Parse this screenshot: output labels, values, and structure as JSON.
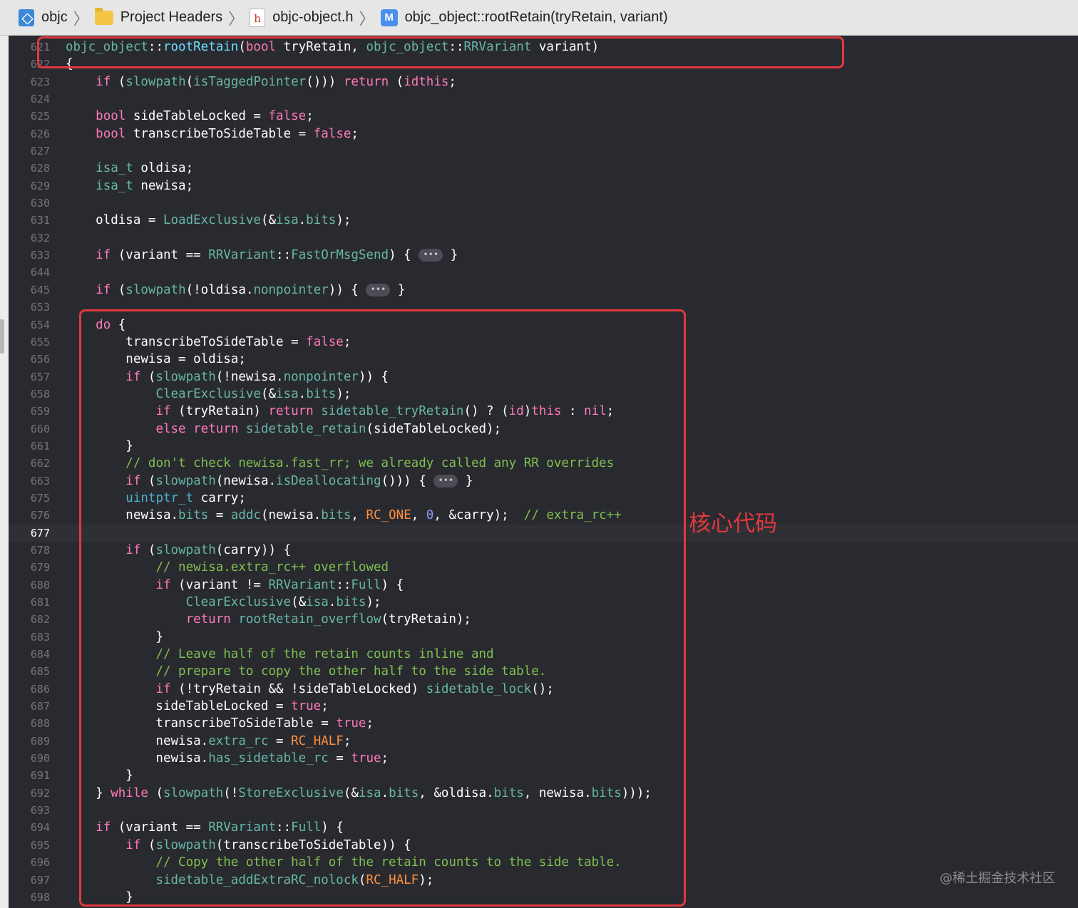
{
  "breadcrumb": {
    "items": [
      {
        "label": "objc",
        "icon": "project-icon"
      },
      {
        "label": "Project Headers",
        "icon": "folder-icon"
      },
      {
        "label": "objc-object.h",
        "icon": "header-file-icon",
        "glyph": "h"
      },
      {
        "label": "objc_object::rootRetain(tryRetain, variant)",
        "icon": "method-icon",
        "glyph": "M"
      }
    ]
  },
  "editor": {
    "current_line": "677",
    "fold_glyph": "•••",
    "lines": [
      {
        "n": "621",
        "tokens": [
          [
            "md",
            "objc_object"
          ],
          [
            "",
            "::"
          ],
          [
            "fg2",
            "rootRetain"
          ],
          [
            "",
            "("
          ],
          [
            "kw",
            "bool"
          ],
          [
            "",
            " tryRetain, "
          ],
          [
            "md",
            "objc_object"
          ],
          [
            "",
            "::"
          ],
          [
            "md",
            "RRVariant"
          ],
          [
            "",
            " variant)"
          ]
        ]
      },
      {
        "n": "622",
        "tokens": [
          [
            "",
            "{"
          ]
        ]
      },
      {
        "n": "623",
        "tokens": [
          [
            "",
            "    "
          ],
          [
            "kw",
            "if"
          ],
          [
            "",
            " ("
          ],
          [
            "fcall",
            "slowpath"
          ],
          [
            "",
            "("
          ],
          [
            "fcall",
            "isTaggedPointer"
          ],
          [
            "",
            "())) "
          ],
          [
            "kw",
            "return"
          ],
          [
            "",
            " ("
          ],
          [
            "kw",
            "id"
          ],
          [
            ")"
          ],
          [
            "kw",
            "this"
          ],
          [
            "",
            ";"
          ]
        ]
      },
      {
        "n": "624",
        "tokens": []
      },
      {
        "n": "625",
        "tokens": [
          [
            "",
            "    "
          ],
          [
            "kw",
            "bool"
          ],
          [
            "",
            " sideTableLocked = "
          ],
          [
            "kw",
            "false"
          ],
          [
            "",
            ";"
          ]
        ]
      },
      {
        "n": "626",
        "tokens": [
          [
            "",
            "    "
          ],
          [
            "kw",
            "bool"
          ],
          [
            "",
            " transcribeToSideTable = "
          ],
          [
            "kw",
            "false"
          ],
          [
            "",
            ";"
          ]
        ]
      },
      {
        "n": "627",
        "tokens": []
      },
      {
        "n": "628",
        "tokens": [
          [
            "",
            "    "
          ],
          [
            "md",
            "isa_t"
          ],
          [
            "",
            " oldisa;"
          ]
        ]
      },
      {
        "n": "629",
        "tokens": [
          [
            "",
            "    "
          ],
          [
            "md",
            "isa_t"
          ],
          [
            "",
            " newisa;"
          ]
        ]
      },
      {
        "n": "630",
        "tokens": []
      },
      {
        "n": "631",
        "tokens": [
          [
            "",
            "    oldisa = "
          ],
          [
            "fcall",
            "LoadExclusive"
          ],
          [
            "",
            "(&"
          ],
          [
            "md",
            "isa"
          ],
          [
            "",
            "."
          ],
          [
            "md",
            "bits"
          ],
          [
            "",
            ");"
          ]
        ]
      },
      {
        "n": "632",
        "tokens": []
      },
      {
        "n": "633",
        "tokens": [
          [
            "",
            "    "
          ],
          [
            "kw",
            "if"
          ],
          [
            "",
            " (variant == "
          ],
          [
            "md",
            "RRVariant"
          ],
          [
            "",
            "::"
          ],
          [
            "md",
            "FastOrMsgSend"
          ],
          [
            "",
            ") { "
          ],
          [
            "fold",
            ""
          ],
          [
            "",
            " }"
          ]
        ]
      },
      {
        "n": "644",
        "tokens": []
      },
      {
        "n": "645",
        "tokens": [
          [
            "",
            "    "
          ],
          [
            "kw",
            "if"
          ],
          [
            "",
            " ("
          ],
          [
            "fcall",
            "slowpath"
          ],
          [
            "",
            "(!oldisa."
          ],
          [
            "md",
            "nonpointer"
          ],
          [
            "",
            ")) { "
          ],
          [
            "fold",
            ""
          ],
          [
            "",
            " }"
          ]
        ]
      },
      {
        "n": "653",
        "tokens": []
      },
      {
        "n": "654",
        "tokens": [
          [
            "",
            "    "
          ],
          [
            "kw",
            "do"
          ],
          [
            "",
            " {"
          ]
        ]
      },
      {
        "n": "655",
        "tokens": [
          [
            "",
            "        transcribeToSideTable = "
          ],
          [
            "kw",
            "false"
          ],
          [
            "",
            ";"
          ]
        ]
      },
      {
        "n": "656",
        "tokens": [
          [
            "",
            "        newisa = oldisa;"
          ]
        ]
      },
      {
        "n": "657",
        "tokens": [
          [
            "",
            "        "
          ],
          [
            "kw",
            "if"
          ],
          [
            "",
            " ("
          ],
          [
            "fcall",
            "slowpath"
          ],
          [
            "",
            "(!newisa."
          ],
          [
            "md",
            "nonpointer"
          ],
          [
            "",
            ")) {"
          ]
        ]
      },
      {
        "n": "658",
        "tokens": [
          [
            "",
            "            "
          ],
          [
            "fcall",
            "ClearExclusive"
          ],
          [
            "",
            "(&"
          ],
          [
            "md",
            "isa"
          ],
          [
            "",
            "."
          ],
          [
            "md",
            "bits"
          ],
          [
            "",
            ");"
          ]
        ]
      },
      {
        "n": "659",
        "tokens": [
          [
            "",
            "            "
          ],
          [
            "kw",
            "if"
          ],
          [
            "",
            " (tryRetain) "
          ],
          [
            "kw",
            "return"
          ],
          [
            "",
            " "
          ],
          [
            "fcall",
            "sidetable_tryRetain"
          ],
          [
            "",
            "() ? ("
          ],
          [
            "kw",
            "id"
          ],
          [
            "",
            ")"
          ],
          [
            "kw",
            "this"
          ],
          [
            "",
            " : "
          ],
          [
            "kw",
            "nil"
          ],
          [
            "",
            ";"
          ]
        ]
      },
      {
        "n": "660",
        "tokens": [
          [
            "",
            "            "
          ],
          [
            "kw",
            "else"
          ],
          [
            "",
            " "
          ],
          [
            "kw",
            "return"
          ],
          [
            "",
            " "
          ],
          [
            "fcall",
            "sidetable_retain"
          ],
          [
            "",
            "(sideTableLocked);"
          ]
        ]
      },
      {
        "n": "661",
        "tokens": [
          [
            "",
            "        }"
          ]
        ]
      },
      {
        "n": "662",
        "tokens": [
          [
            "",
            "        "
          ],
          [
            "cm",
            "// don't check newisa.fast_rr; we already called any RR overrides"
          ]
        ]
      },
      {
        "n": "663",
        "tokens": [
          [
            "",
            "        "
          ],
          [
            "kw",
            "if"
          ],
          [
            "",
            " ("
          ],
          [
            "fcall",
            "slowpath"
          ],
          [
            "",
            "(newisa."
          ],
          [
            "fcall",
            "isDeallocating"
          ],
          [
            "",
            "())) { "
          ],
          [
            "fold",
            ""
          ],
          [
            "",
            " }"
          ]
        ]
      },
      {
        "n": "675",
        "tokens": [
          [
            "",
            "        "
          ],
          [
            "id",
            "uintptr_t"
          ],
          [
            "",
            " carry;"
          ]
        ]
      },
      {
        "n": "676",
        "tokens": [
          [
            "",
            "        newisa."
          ],
          [
            "md",
            "bits"
          ],
          [
            "",
            " = "
          ],
          [
            "fcall",
            "addc"
          ],
          [
            "",
            "(newisa."
          ],
          [
            "md",
            "bits"
          ],
          [
            "",
            ", "
          ],
          [
            "cn",
            "RC_ONE"
          ],
          [
            "",
            ", "
          ],
          [
            "nm",
            "0"
          ],
          [
            "",
            ", &carry);  "
          ],
          [
            "cm",
            "// extra_rc++"
          ]
        ]
      },
      {
        "n": "677",
        "tokens": []
      },
      {
        "n": "678",
        "tokens": [
          [
            "",
            "        "
          ],
          [
            "kw",
            "if"
          ],
          [
            "",
            " ("
          ],
          [
            "fcall",
            "slowpath"
          ],
          [
            "",
            "(carry)) {"
          ]
        ]
      },
      {
        "n": "679",
        "tokens": [
          [
            "",
            "            "
          ],
          [
            "cm",
            "// newisa.extra_rc++ overflowed"
          ]
        ]
      },
      {
        "n": "680",
        "tokens": [
          [
            "",
            "            "
          ],
          [
            "kw",
            "if"
          ],
          [
            "",
            " (variant != "
          ],
          [
            "md",
            "RRVariant"
          ],
          [
            "",
            "::"
          ],
          [
            "md",
            "Full"
          ],
          [
            "",
            ") {"
          ]
        ]
      },
      {
        "n": "681",
        "tokens": [
          [
            "",
            "                "
          ],
          [
            "fcall",
            "ClearExclusive"
          ],
          [
            "",
            "(&"
          ],
          [
            "md",
            "isa"
          ],
          [
            "",
            "."
          ],
          [
            "md",
            "bits"
          ],
          [
            "",
            ");"
          ]
        ]
      },
      {
        "n": "682",
        "tokens": [
          [
            "",
            "                "
          ],
          [
            "kw",
            "return"
          ],
          [
            "",
            " "
          ],
          [
            "fcall",
            "rootRetain_overflow"
          ],
          [
            "",
            "(tryRetain);"
          ]
        ]
      },
      {
        "n": "683",
        "tokens": [
          [
            "",
            "            }"
          ]
        ]
      },
      {
        "n": "684",
        "tokens": [
          [
            "",
            "            "
          ],
          [
            "cm",
            "// Leave half of the retain counts inline and"
          ]
        ]
      },
      {
        "n": "685",
        "tokens": [
          [
            "",
            "            "
          ],
          [
            "cm",
            "// prepare to copy the other half to the side table."
          ]
        ]
      },
      {
        "n": "686",
        "tokens": [
          [
            "",
            "            "
          ],
          [
            "kw",
            "if"
          ],
          [
            "",
            " (!tryRetain && !sideTableLocked) "
          ],
          [
            "fcall",
            "sidetable_lock"
          ],
          [
            "",
            "();"
          ]
        ]
      },
      {
        "n": "687",
        "tokens": [
          [
            "",
            "            sideTableLocked = "
          ],
          [
            "kw",
            "true"
          ],
          [
            "",
            ";"
          ]
        ]
      },
      {
        "n": "688",
        "tokens": [
          [
            "",
            "            transcribeToSideTable = "
          ],
          [
            "kw",
            "true"
          ],
          [
            "",
            ";"
          ]
        ]
      },
      {
        "n": "689",
        "tokens": [
          [
            "",
            "            newisa."
          ],
          [
            "md",
            "extra_rc"
          ],
          [
            "",
            " = "
          ],
          [
            "cn",
            "RC_HALF"
          ],
          [
            "",
            ";"
          ]
        ]
      },
      {
        "n": "690",
        "tokens": [
          [
            "",
            "            newisa."
          ],
          [
            "md",
            "has_sidetable_rc"
          ],
          [
            "",
            " = "
          ],
          [
            "kw",
            "true"
          ],
          [
            "",
            ";"
          ]
        ]
      },
      {
        "n": "691",
        "tokens": [
          [
            "",
            "        }"
          ]
        ]
      },
      {
        "n": "692",
        "tokens": [
          [
            "",
            "    } "
          ],
          [
            "kw",
            "while"
          ],
          [
            "",
            " ("
          ],
          [
            "fcall",
            "slowpath"
          ],
          [
            "",
            "(!"
          ],
          [
            "fcall",
            "StoreExclusive"
          ],
          [
            "",
            "(&"
          ],
          [
            "md",
            "isa"
          ],
          [
            "",
            "."
          ],
          [
            "md",
            "bits"
          ],
          [
            "",
            ", &oldisa."
          ],
          [
            "md",
            "bits"
          ],
          [
            "",
            ", newisa."
          ],
          [
            "md",
            "bits"
          ],
          [
            "",
            ")));"
          ]
        ]
      },
      {
        "n": "693",
        "tokens": []
      },
      {
        "n": "694",
        "tokens": [
          [
            "",
            "    "
          ],
          [
            "kw",
            "if"
          ],
          [
            "",
            " (variant == "
          ],
          [
            "md",
            "RRVariant"
          ],
          [
            "",
            "::"
          ],
          [
            "md",
            "Full"
          ],
          [
            "",
            ") {"
          ]
        ]
      },
      {
        "n": "695",
        "tokens": [
          [
            "",
            "        "
          ],
          [
            "kw",
            "if"
          ],
          [
            "",
            " ("
          ],
          [
            "fcall",
            "slowpath"
          ],
          [
            "",
            "(transcribeToSideTable)) {"
          ]
        ]
      },
      {
        "n": "696",
        "tokens": [
          [
            "",
            "            "
          ],
          [
            "cm",
            "// Copy the other half of the retain counts to the side table."
          ]
        ]
      },
      {
        "n": "697",
        "tokens": [
          [
            "",
            "            "
          ],
          [
            "fcall",
            "sidetable_addExtraRC_nolock"
          ],
          [
            "",
            "("
          ],
          [
            "cn",
            "RC_HALF"
          ],
          [
            "",
            ");"
          ]
        ]
      },
      {
        "n": "698",
        "tokens": [
          [
            "",
            "        }"
          ]
        ]
      }
    ]
  },
  "annotation": {
    "label": "核心代码",
    "color": "#e1393e"
  },
  "watermark": "@稀土掘金技术社区"
}
